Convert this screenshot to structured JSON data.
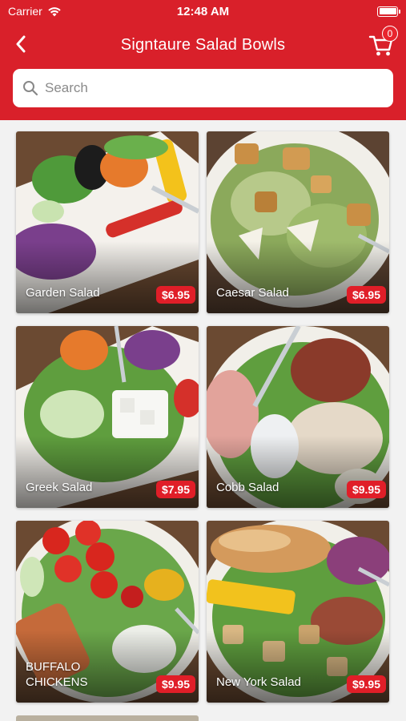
{
  "status": {
    "carrier": "Carrier",
    "time": "12:48 AM"
  },
  "nav": {
    "title": "Signtaure Salad Bowls",
    "cart_count": "0"
  },
  "search": {
    "placeholder": "Search"
  },
  "items": [
    {
      "name": "Garden Salad",
      "price": "$6.95"
    },
    {
      "name": "Caesar Salad",
      "price": "$6.95"
    },
    {
      "name": "Greek Salad",
      "price": "$7.95"
    },
    {
      "name": "Cobb Salad",
      "price": "$9.95"
    },
    {
      "name": "BUFFALO CHICKENS",
      "price": "$9.95"
    },
    {
      "name": "New York Salad",
      "price": "$9.95"
    }
  ],
  "colors": {
    "brand": "#d9202a",
    "price_badge": "#e01e28"
  },
  "icons": {
    "back": "chevron-left-icon",
    "cart": "cart-icon",
    "search": "search-icon",
    "wifi": "wifi-icon",
    "battery": "battery-icon"
  }
}
